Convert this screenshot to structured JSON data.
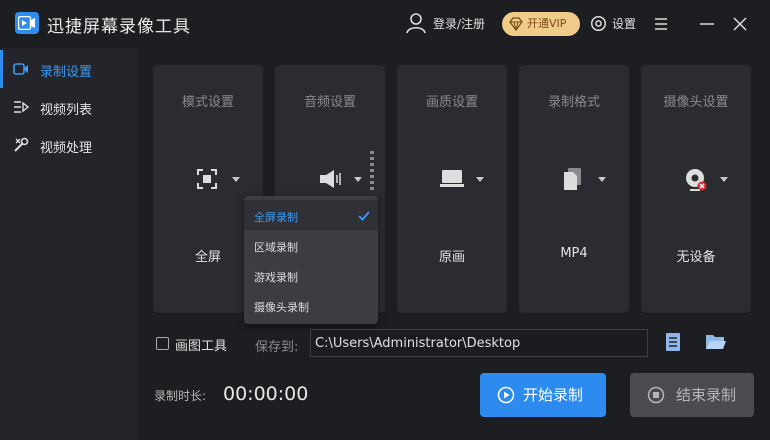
{
  "app": {
    "title": "迅捷屏幕录像工具"
  },
  "header": {
    "login_label": "登录/注册",
    "vip_label": "开通VIP",
    "settings_label": "设置",
    "vip_color": "#f0cc8a",
    "accent": "#2f8df0"
  },
  "sidebar": {
    "items": [
      {
        "label": "录制设置",
        "icon": "record-settings-icon",
        "active": true
      },
      {
        "label": "视频列表",
        "icon": "list-icon",
        "active": false
      },
      {
        "label": "视频处理",
        "icon": "tools-icon",
        "active": false
      }
    ]
  },
  "cards": [
    {
      "title": "模式设置",
      "value": "全屏",
      "icon": "fullscreen-icon"
    },
    {
      "title": "音频设置",
      "value": "",
      "icon": "speaker-icon"
    },
    {
      "title": "画质设置",
      "value": "原画",
      "icon": "monitor-icon"
    },
    {
      "title": "录制格式",
      "value": "MP4",
      "icon": "file-icon"
    },
    {
      "title": "摄像头设置",
      "value": "无设备",
      "icon": "camera-icon"
    }
  ],
  "mode_dropdown": {
    "options": [
      "全屏录制",
      "区域录制",
      "游戏录制",
      "摄像头录制"
    ],
    "selected": "全屏录制"
  },
  "bottom": {
    "draw_tool_label": "画图工具",
    "save_label": "保存到:",
    "save_path": "C:\\Users\\Administrator\\Desktop",
    "duration_label": "录制时长:",
    "duration_value": "00:00:00",
    "start_label": "开始录制",
    "stop_label": "结束录制"
  }
}
